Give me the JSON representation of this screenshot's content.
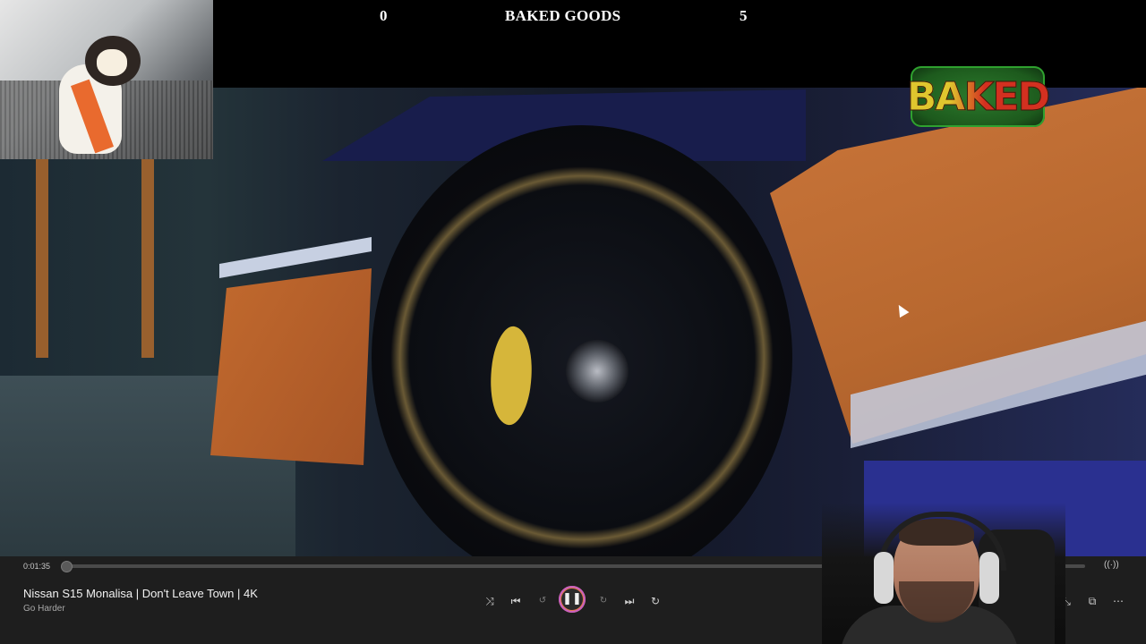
{
  "scoreboard": {
    "left_score": "0",
    "title": "BAKED GOODS",
    "right_score": "5"
  },
  "logo": {
    "text": "BAKED"
  },
  "player": {
    "time_elapsed": "0:01:35",
    "progress_fraction": 0.003,
    "track_title": "Nissan S15 Monalisa | Don't Leave Town | 4K",
    "track_artist": "Go Harder",
    "controls": {
      "shuffle_icon": "⤨",
      "prev_icon": "⏮",
      "back10_label": "↺",
      "play_pause_icon": "❚❚",
      "fwd30_label": "↻",
      "next_icon": "⏭",
      "repeat_icon": "↻",
      "fullscreen_icon": "⛶",
      "minimize_icon": "⤡",
      "miniplayer_icon": "⧉",
      "more_icon": "⋯",
      "seek_end_icon": "((·))"
    },
    "icon_names": [
      "shuffle-icon",
      "previous-icon",
      "rewind-10-icon",
      "pause-icon",
      "forward-30-icon",
      "next-icon",
      "repeat-off-icon",
      "fullscreen-icon",
      "minimize-icon",
      "miniplayer-icon",
      "more-icon",
      "cast-icon"
    ],
    "accent_colors": {
      "play_ring_a": "#c860c0",
      "play_ring_b": "#e37a4a"
    }
  }
}
